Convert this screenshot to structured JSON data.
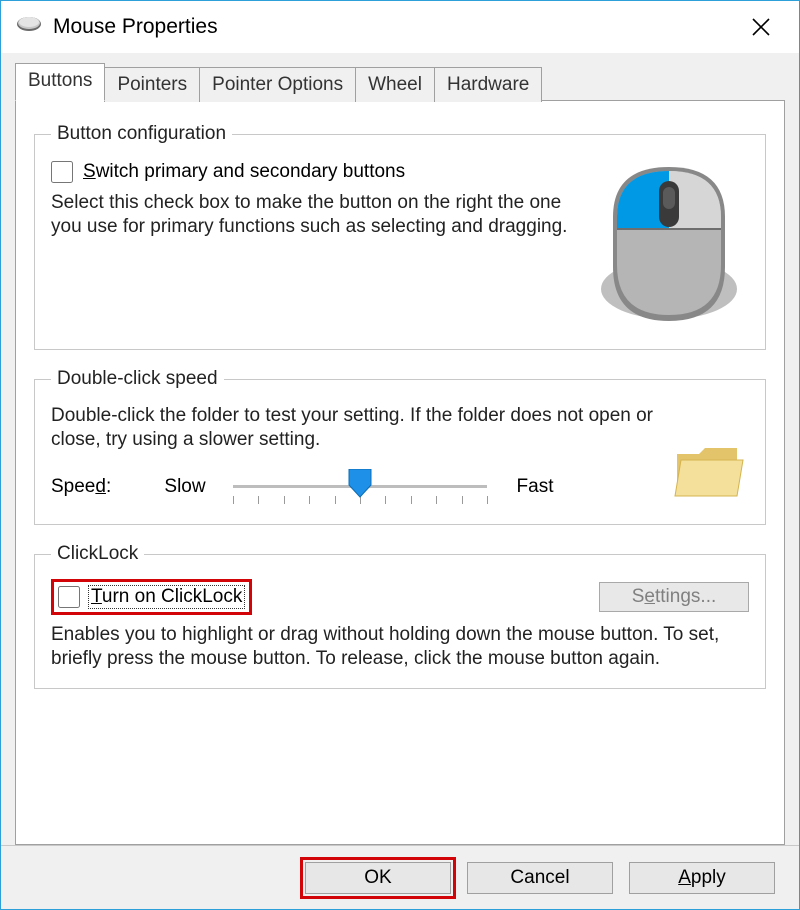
{
  "window": {
    "title": "Mouse Properties"
  },
  "tabs": {
    "buttons": "Buttons",
    "pointers": "Pointers",
    "pointer_options": "Pointer Options",
    "wheel": "Wheel",
    "hardware": "Hardware"
  },
  "group_button_config": {
    "legend": "Button configuration",
    "checkbox_pre": "S",
    "checkbox_main": "witch primary and secondary buttons",
    "desc": "Select this check box to make the button on the right the one you use for primary functions such as selecting and dragging."
  },
  "group_dcs": {
    "legend": "Double-click speed",
    "desc": "Double-click the folder to test your setting. If the folder does not open or close, try using a slower setting.",
    "speed_pre": "Spee",
    "speed_u": "d",
    "speed_post": ":",
    "slow": "Slow",
    "fast": "Fast"
  },
  "group_clicklock": {
    "legend": "ClickLock",
    "checkbox_u": "T",
    "checkbox_main": "urn on ClickLock",
    "settings_pre": "S",
    "settings_u": "e",
    "settings_post": "ttings...",
    "desc": "Enables you to highlight or drag without holding down the mouse button. To set, briefly press the mouse button. To release, click the mouse button again."
  },
  "buttons": {
    "ok": "OK",
    "cancel": "Cancel",
    "apply_u": "A",
    "apply_post": "pply"
  }
}
